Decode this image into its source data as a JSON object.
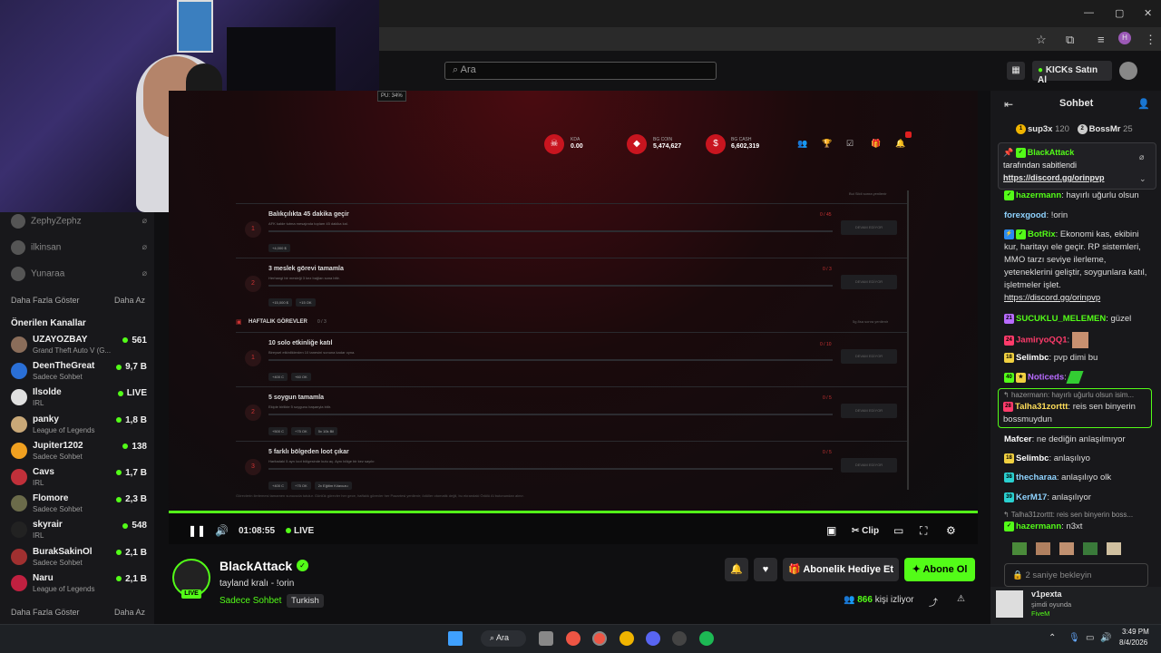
{
  "kick": {
    "search_placeholder": "Ara",
    "buy_kicks": "KICKs Satın Al"
  },
  "overlay": {
    "cpu": "PU: 34%"
  },
  "left_sidebar": {
    "followed": [
      {
        "name": "ZephyZephz"
      },
      {
        "name": "ilkinsan"
      },
      {
        "name": "Yunaraa"
      }
    ],
    "show_more": "Daha Fazla Göster",
    "show_less": "Daha Az",
    "recommended_title": "Önerilen Kanallar",
    "recommended": [
      {
        "name": "UZAYOZBAY",
        "category": "Grand Theft Auto V (G...",
        "viewers": "561",
        "color": "#8a6d5a"
      },
      {
        "name": "DeenTheGreat",
        "category": "Sadece Sohbet",
        "viewers": "9,7 B",
        "color": "#2a6fd6"
      },
      {
        "name": "Ilsolde",
        "category": "IRL",
        "viewers": "LIVE",
        "color": "#e0e0e0"
      },
      {
        "name": "panky",
        "category": "League of Legends",
        "viewers": "1,8 B",
        "color": "#c9a878"
      },
      {
        "name": "Jupiter1202",
        "category": "Sadece Sohbet",
        "viewers": "138",
        "color": "#f0a020"
      },
      {
        "name": "Cavs",
        "category": "IRL",
        "viewers": "1,7 B",
        "color": "#c0303a"
      },
      {
        "name": "Flomore",
        "category": "Sadece Sohbet",
        "viewers": "2,3 B",
        "color": "#6b6b4a"
      },
      {
        "name": "skyrair",
        "category": "IRL",
        "viewers": "548",
        "color": "#222"
      },
      {
        "name": "BurakSakinOl",
        "category": "Sadece Sohbet",
        "viewers": "2,1 B",
        "color": "#a03030"
      },
      {
        "name": "Naru",
        "category": "League of Legends",
        "viewers": "2,1 B",
        "color": "#c02040"
      }
    ]
  },
  "game": {
    "stats": [
      {
        "label": "KDA",
        "value": "0.00"
      },
      {
        "label": "BG COIN",
        "value": "5,474,627"
      },
      {
        "label": "BG CASH",
        "value": "6,602,319"
      }
    ],
    "daily_top_note": "Bui Sildi sonra yenilenir",
    "weekly_title": "HAFTALIK GÖREVLER",
    "weekly_count": "0 / 3",
    "weekly_note": "5g 8sa sonra yenilenir",
    "tasks": [
      {
        "num": "1",
        "title": "Balıkçılıkta 45 dakika geçir",
        "desc": "AFK kalde tutma mesajında toplam 45 dakika kal.",
        "progress": "0 / 45",
        "action": "DEVAM EDİYOR",
        "chips": [
          "+4,000 $"
        ]
      },
      {
        "num": "2",
        "title": "3 meslek görevi tamamla",
        "desc": "Herhangi bir mesleği 3 kez bağlan sona bitir.",
        "progress": "0 / 3",
        "action": "DEVAM EDİYOR",
        "chips": [
          "+15,000 $",
          "+15 OK"
        ]
      },
      {
        "num": "1",
        "title": "10 solo etkinliğe katıl",
        "desc": "Bireysel etkinliklerden 10 tanesini sonuna kadar oyna.",
        "progress": "0 / 10",
        "action": "DEVAM EDİYOR",
        "chips": [
          "+400 C",
          "+60 OK"
        ]
      },
      {
        "num": "2",
        "title": "5 soygun tamamla",
        "desc": "Ekiple birlikte 5 soygunu başarıyla bitir.",
        "progress": "0 / 5",
        "action": "DEVAM EDİYOR",
        "chips": [
          "+500 C",
          "+75 OK",
          "5x 10k Bil"
        ]
      },
      {
        "num": "3",
        "title": "5 farklı bölgeden loot çıkar",
        "desc": "Haritadaki 5 ayrı loot bölgesinde kutu aç. Aynı bölge bir kez sayılır.",
        "progress": "0 / 5",
        "action": "DEVAM EDİYOR",
        "chips": [
          "+400 C",
          "+75 OK",
          "2x Eğitim Kılavuzu"
        ]
      }
    ],
    "footer_note": "Görevlerin ilerlemesi tamamen sunucuda tutulur. Günlük görevler her gece, haftalık görevler her Pazartesi yenilenir; ödüller otomatik değil, bu ekrandaki Ödülü Al butonundan alınır."
  },
  "player": {
    "time": "01:08:55",
    "live": "LIVE",
    "clip": "Clip",
    "progress": 1.0
  },
  "stream": {
    "channel": "BlackAttack",
    "live_badge": "LIVE",
    "title": "tayland kralı - !orin",
    "category": "Sadece Sohbet",
    "tag": "Turkish",
    "gift_sub": "Abonelik Hediye Et",
    "subscribe": "Abone Ol",
    "viewers": "866",
    "viewers_suffix": "kişi izliyor"
  },
  "chat": {
    "title": "Sohbet",
    "top_gifters": [
      {
        "rank": "1",
        "name": "sup3x",
        "count": "120"
      },
      {
        "rank": "2",
        "name": "BossMr",
        "count": "25"
      }
    ],
    "pinned": {
      "user": "BlackAttack",
      "by_text": "tarafından sabitlendi",
      "link": "https://discord.gg/orinpvp"
    },
    "messages": [
      {
        "user": "hazermann",
        "color": "#53fc18",
        "text": "hayırlı uğurlu olsun"
      },
      {
        "user": "forexgood",
        "color": "#8fd3ff",
        "text": "!orin"
      },
      {
        "user": "BotRix",
        "color": "#53fc18",
        "text": "Ekonomi kas, ekibini kur, haritayı ele geçir. RP sistemleri, MMO tarzı seviye ilerleme, yeteneklerini geliştir, soygunlara katıl, işletmeler işlet.",
        "link": "https://discord.gg/orinpvp"
      },
      {
        "user": "SUCUKLU_MELEMEN",
        "color": "#53fc18",
        "text": "güzel"
      },
      {
        "user": "JamiryoQQ1",
        "color": "#ff3b6b",
        "text": ""
      },
      {
        "user": "Selimbc",
        "color": "#ffffff",
        "text": "pvp dimi bu"
      },
      {
        "user": "Noticeds",
        "color": "#b86bff",
        "text": ""
      }
    ],
    "reply": {
      "quote": "hazermann: hayırlı uğurlu olsun isim...",
      "user": "Talha31zorttt",
      "color": "#ffde5a",
      "text": "reis sen binyerin bossmuydun"
    },
    "messages2": [
      {
        "user": "Mafcer",
        "color": "#ffffff",
        "text": "ne dediğin anlaşılmıyor"
      },
      {
        "user": "Selimbc",
        "color": "#ffffff",
        "text": "anlaşılıyo"
      },
      {
        "user": "thecharaa",
        "color": "#8fd3ff",
        "text": "anlaşılıyo olk"
      },
      {
        "user": "KerM17",
        "color": "#8fd3ff",
        "text": "anlaşılıyor"
      }
    ],
    "reply2_quote": "Talha31zorttt: reis sen binyerin boss...",
    "reply2": {
      "user": "hazermann",
      "color": "#53fc18",
      "text": "n3xt"
    },
    "input_placeholder": "2 saniye bekleyin"
  },
  "notification": {
    "user": "v1pexta",
    "status": "şimdi oyunda",
    "game": "FiveM"
  },
  "taskbar": {
    "search": "Ara",
    "time": "3:49 PM",
    "date": "8/4/2026"
  }
}
